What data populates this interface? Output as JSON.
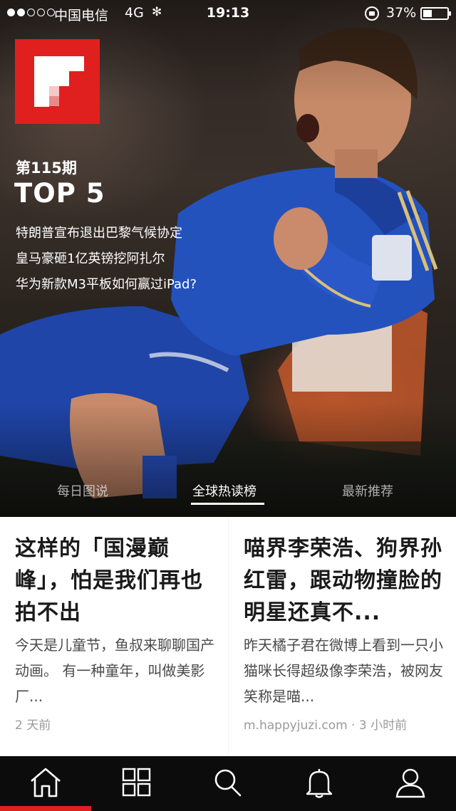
{
  "status_bar": {
    "carrier": "中国电信",
    "network": "4G",
    "time": "19:13",
    "battery_percent": "37%",
    "signal_bars_filled": 2,
    "signal_bars_total": 5,
    "battery_level": 0.37
  },
  "colors": {
    "brand_red": "#e0201f",
    "nav_background": "#0c0c0c"
  },
  "hero": {
    "issue_label": "第115期",
    "title": "TOP 5",
    "headlines": [
      "特朗普宣布退出巴黎气候协定",
      "皇马豪砸1亿英镑挖阿扎尔",
      "华为新款M3平板如何赢过iPad?"
    ],
    "tabs": [
      {
        "label": "每日图说",
        "active": false
      },
      {
        "label": "全球热读榜",
        "active": true
      },
      {
        "label": "最新推荐",
        "active": false
      }
    ]
  },
  "cards": [
    {
      "title": "这样的「国漫巅峰」，怕是我们再也拍不出",
      "summary": "今天是儿童节，鱼叔来聊聊国产动画。 有一种童年，叫做美影厂...",
      "meta": "2 天前"
    },
    {
      "title": "喵界李荣浩、狗界孙红雷，跟动物撞脸的明星还真不...",
      "summary": "昨天橘子君在微博上看到一只小猫咪长得超级像李荣浩，被网友笑称是喵...",
      "meta": "m.happyjuzi.com · 3 小时前"
    }
  ],
  "bottom_nav": [
    {
      "name": "home",
      "icon": "home-icon",
      "active": true
    },
    {
      "name": "explore",
      "icon": "grid-icon",
      "active": false
    },
    {
      "name": "search",
      "icon": "search-icon",
      "active": false
    },
    {
      "name": "notifications",
      "icon": "bell-icon",
      "active": false
    },
    {
      "name": "profile",
      "icon": "user-icon",
      "active": false
    }
  ]
}
